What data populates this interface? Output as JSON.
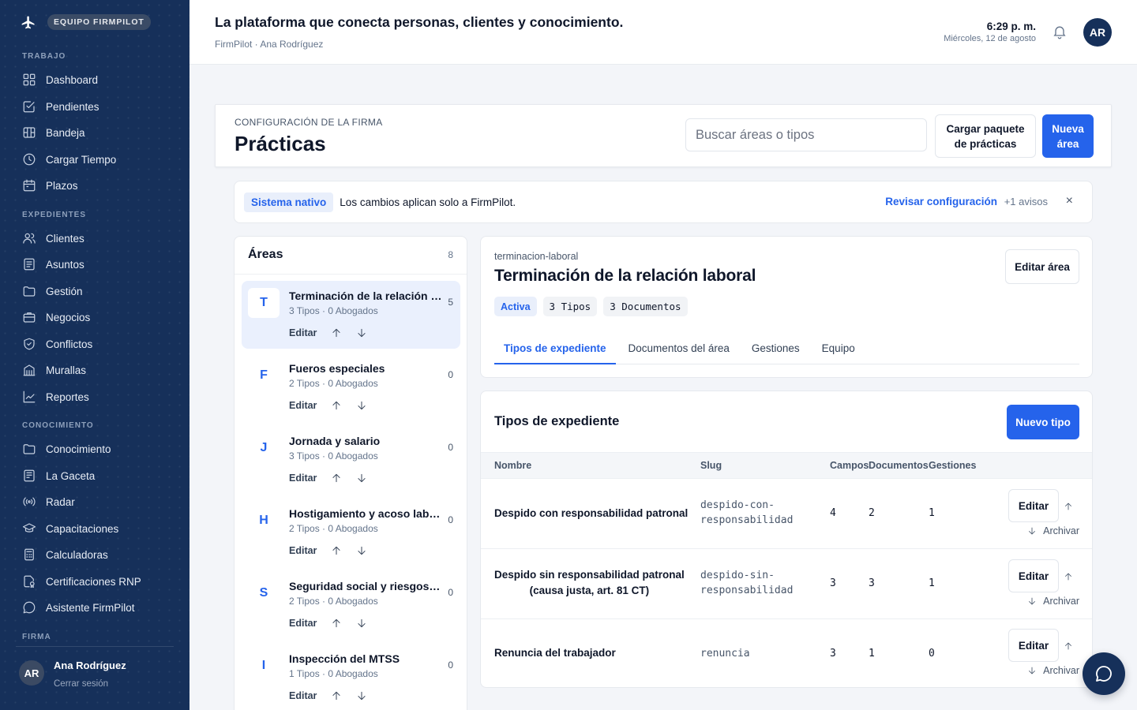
{
  "sidebar": {
    "team_label": "EQUIPO FIRMPILOT",
    "sections": [
      {
        "label": "TRABAJO",
        "items": [
          {
            "label": "Dashboard",
            "icon": "grid-icon"
          },
          {
            "label": "Pendientes",
            "icon": "checkbox-icon"
          },
          {
            "label": "Bandeja",
            "icon": "inbox-icon"
          },
          {
            "label": "Cargar Tiempo",
            "icon": "clock-icon"
          },
          {
            "label": "Plazos",
            "icon": "calendar-icon"
          }
        ]
      },
      {
        "label": "EXPEDIENTES",
        "items": [
          {
            "label": "Clientes",
            "icon": "users-icon"
          },
          {
            "label": "Asuntos",
            "icon": "document-icon"
          },
          {
            "label": "Gestión",
            "icon": "folder-icon"
          },
          {
            "label": "Negocios",
            "icon": "briefcase-icon"
          },
          {
            "label": "Conflictos",
            "icon": "shield-icon"
          },
          {
            "label": "Murallas",
            "icon": "building-icon"
          },
          {
            "label": "Reportes",
            "icon": "chart-line-icon"
          }
        ]
      },
      {
        "label": "CONOCIMIENTO",
        "items": [
          {
            "label": "Conocimiento",
            "icon": "folder-icon"
          },
          {
            "label": "La Gaceta",
            "icon": "newspaper-icon"
          },
          {
            "label": "Radar",
            "icon": "radar-icon"
          },
          {
            "label": "Capacitaciones",
            "icon": "graduation-cap-icon"
          },
          {
            "label": "Calculadoras",
            "icon": "calculator-icon"
          },
          {
            "label": "Certificaciones RNP",
            "icon": "certificate-icon"
          },
          {
            "label": "Asistente FirmPilot",
            "icon": "chat-bubble-icon"
          }
        ]
      },
      {
        "label": "FIRMA",
        "items": []
      }
    ],
    "user": {
      "initials": "AR",
      "name": "Ana Rodríguez",
      "logout_label": "Cerrar sesión"
    }
  },
  "header": {
    "title": "La plataforma que conecta personas, clientes y conocimiento.",
    "breadcrumb": "FirmPilot · Ana Rodríguez",
    "time": "6:29 p. m.",
    "date": "Miércoles, 12 de agosto",
    "avatar_initials": "AR"
  },
  "page": {
    "eyebrow": "CONFIGURACIÓN DE LA FIRMA",
    "title": "Prácticas",
    "search_placeholder": "Buscar áreas o tipos",
    "load_package_label": "Cargar paquete de prácticas",
    "new_area_label": "Nueva área"
  },
  "banner": {
    "badge": "Sistema nativo",
    "text": "Los cambios aplican solo a FirmPilot.",
    "link": "Revisar configuración",
    "count": "+1 avisos",
    "close": "×"
  },
  "areas": {
    "title": "Áreas",
    "count": "8",
    "edit_label": "Editar",
    "items": [
      {
        "letter": "T",
        "name": "Terminación de la relación laboral",
        "meta": "3 Tipos · 0 Abogados",
        "count": "5",
        "active": true
      },
      {
        "letter": "F",
        "name": "Fueros especiales",
        "meta": "2 Tipos · 0 Abogados",
        "count": "0",
        "active": false
      },
      {
        "letter": "J",
        "name": "Jornada y salario",
        "meta": "3 Tipos · 0 Abogados",
        "count": "0",
        "active": false
      },
      {
        "letter": "H",
        "name": "Hostigamiento y acoso laboral",
        "meta": "2 Tipos · 0 Abogados",
        "count": "0",
        "active": false
      },
      {
        "letter": "S",
        "name": "Seguridad social y riesgos del trabajo",
        "meta": "2 Tipos · 0 Abogados",
        "count": "0",
        "active": false
      },
      {
        "letter": "I",
        "name": "Inspección del MTSS",
        "meta": "1 Tipos · 0 Abogados",
        "count": "0",
        "active": false
      }
    ]
  },
  "detail": {
    "slug": "terminacion-laboral",
    "title": "Terminación de la relación laboral",
    "status": "Activa",
    "types_chip": "3 Tipos",
    "docs_chip": "3 Documentos",
    "edit_label": "Editar área",
    "tabs": [
      "Tipos de expediente",
      "Documentos del área",
      "Gestiones",
      "Equipo"
    ]
  },
  "types": {
    "title": "Tipos de expediente",
    "new_label": "Nuevo tipo",
    "columns": [
      "Nombre",
      "Slug",
      "Campos",
      "Documentos",
      "Gestiones"
    ],
    "edit_label": "Editar",
    "archive_label": "Archivar",
    "rows": [
      {
        "name": "Despido con responsabilidad patronal",
        "slug": "despido-con-\nresponsabilidad",
        "fields": "4",
        "docs": "2",
        "tasks": "1"
      },
      {
        "name": "Despido sin responsabilidad patronal\n(causa justa, art. 81 CT)",
        "slug": "despido-sin-\nresponsabilidad",
        "fields": "3",
        "docs": "3",
        "tasks": "1"
      },
      {
        "name": "Renuncia del trabajador",
        "slug": "renuncia",
        "fields": "3",
        "docs": "1",
        "tasks": "0"
      }
    ]
  }
}
